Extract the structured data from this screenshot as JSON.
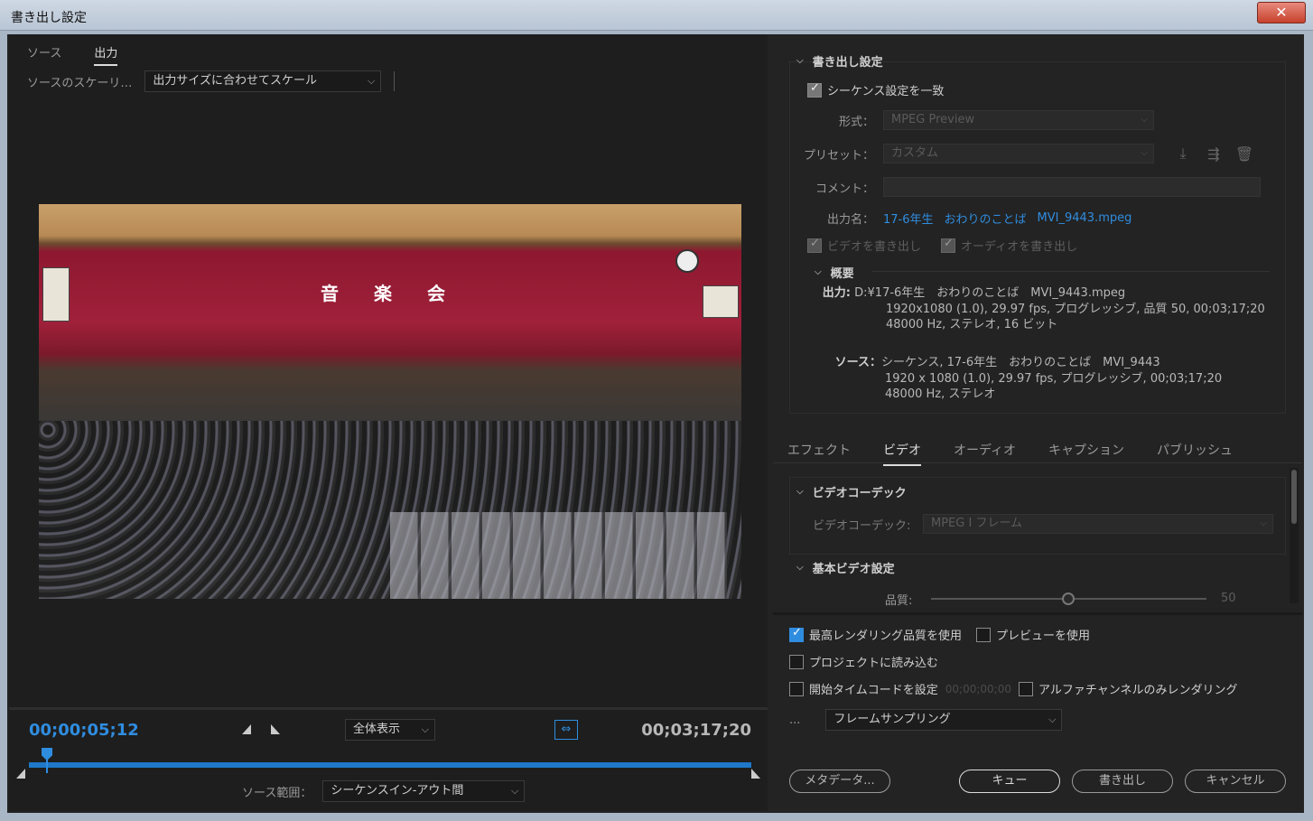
{
  "window": {
    "title": "書き出し設定",
    "close": "✕"
  },
  "source_tabs": [
    {
      "label": "ソース"
    },
    {
      "label": "出力"
    }
  ],
  "scaling": {
    "label": "ソースのスケーリ…",
    "value": "出力サイズに合わせてスケール"
  },
  "preview_scene": {
    "banner": "音 楽 会"
  },
  "timeline": {
    "current_tc": "00;00;05;12",
    "duration_tc": "00;03;17;20",
    "zoom": "全体表示",
    "fit_icon": "fit-frame-icon",
    "source_range_label": "ソース範囲：",
    "source_range_value": "シーケンスイン-アウト間"
  },
  "export_settings": {
    "section": "書き出し設定",
    "match_sequence": "シーケンス設定を一致",
    "format_label": "形式：",
    "format_value": "MPEG Preview",
    "preset_label": "プリセット：",
    "preset_value": "カスタム",
    "comment_label": "コメント：",
    "output_name_label": "出力名：",
    "output_name_parts": [
      "17-6年生",
      "おわりのことば",
      "MVI_9443.mpeg"
    ],
    "export_video": "ビデオを書き出し",
    "export_audio": "オーディオを書き出し"
  },
  "summary": {
    "section": "概要",
    "output_key": "出力:",
    "output_lines": [
      "D:¥17-6年生　おわりのことば　MVI_9443.mpeg",
      "1920x1080 (1.0), 29.97 fps, プログレッシブ, 品質 50, 00;03;17;20",
      "48000 Hz, ステレオ, 16 ビット"
    ],
    "source_key": "ソース：",
    "source_lines": [
      "シーケンス, 17-6年生　おわりのことば　MVI_9443",
      "1920 x 1080 (1.0), 29.97 fps, プログレッシブ, 00;03;17;20",
      "48000 Hz, ステレオ"
    ]
  },
  "settings_tabs": [
    {
      "label": "エフェクト"
    },
    {
      "label": "ビデオ"
    },
    {
      "label": "オーディオ"
    },
    {
      "label": "キャプション"
    },
    {
      "label": "パブリッシュ"
    }
  ],
  "video": {
    "codec_section": "ビデオコーデック",
    "codec_label": "ビデオコーデック:",
    "codec_value": "MPEG I フレーム",
    "basic_section": "基本ビデオ設定",
    "quality_label": "品質:",
    "quality_value": "50"
  },
  "options": {
    "max_render": "最高レンダリング品質を使用",
    "use_preview": "プレビューを使用",
    "import_project": "プロジェクトに読み込む",
    "set_start_tc": "開始タイムコードを設定",
    "start_tc_value": "00;00;00;00",
    "alpha_only": "アルファチャンネルのみレンダリング",
    "ellipsis": "...",
    "frame_sampling": "フレームサンプリング"
  },
  "buttons": {
    "metadata": "メタデータ...",
    "queue": "キュー",
    "export": "書き出し",
    "cancel": "キャンセル"
  },
  "colors": {
    "accent": "#2f8de0",
    "background": "#232323"
  }
}
